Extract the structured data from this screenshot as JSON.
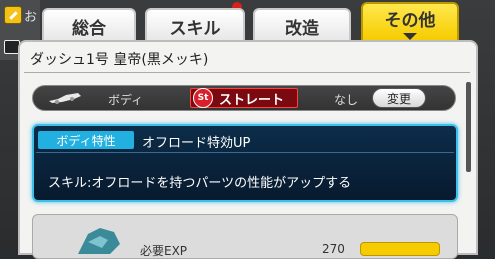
{
  "tabs": [
    {
      "label": "総合"
    },
    {
      "label": "スキル"
    },
    {
      "label": "改造"
    },
    {
      "label": "その他"
    }
  ],
  "background": {
    "partial_text": "お"
  },
  "panel": {
    "title": "ダッシュ1号 皇帝(黒メッキ)",
    "part": {
      "icon": "car-body-icon",
      "type": "ボディ",
      "badge_icon_text": "St",
      "badge_label": "ストレート",
      "status": "なし",
      "change_button": "変更"
    },
    "trait": {
      "label": "ボディ特性",
      "name": "オフロード特効UP",
      "description": "スキル:オフロードを持つパーツの性能がアップする"
    },
    "upgrade": {
      "exp_label": "必要EXP",
      "exp_value": "270"
    }
  },
  "colors": {
    "active_tab": "#f6cc00",
    "trait_border": "#3cc0e8",
    "badge_red": "#d9202a"
  }
}
